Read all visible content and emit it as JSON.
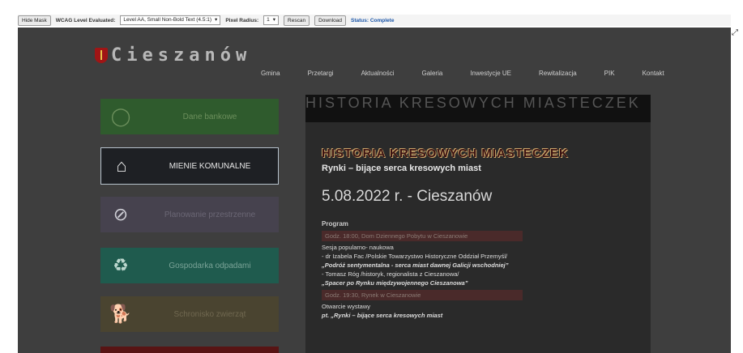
{
  "toolbar": {
    "hide_mask": "Hide Mask",
    "wcag_label": "WCAG Level Evaluated:",
    "wcag_value": "Level AA, Small Non-Bold Text (4.5:1)",
    "pixel_radius_label": "Pixel Radius:",
    "pixel_radius_value": "1",
    "rescan": "Rescan",
    "download": "Download",
    "status": "Status: Complete"
  },
  "site": {
    "logo_text": "Cieszanów",
    "nav": [
      "Gmina",
      "Przetargi",
      "Aktualności",
      "Galeria",
      "Inwestycje UE",
      "Rewitalizacja",
      "PIK",
      "Kontakt"
    ]
  },
  "tiles": [
    {
      "label": "Dane bankowe",
      "icon": "shield-outline-icon"
    },
    {
      "label": "MIENIE KOMUNALNE",
      "icon": "house-icon"
    },
    {
      "label": "Planowanie przestrzenne",
      "icon": "compass-icon"
    },
    {
      "label": "Gospodarka odpadami",
      "icon": "recycle-icon"
    },
    {
      "label": "Schronisko zwierząt",
      "icon": "dog-icon"
    }
  ],
  "article": {
    "banner": "HISTORIA KRESOWYCH MIASTECZEK",
    "title": "HISTORIA KRESOWYCH MIASTECZEK",
    "subtitle": "Rynki – bijące serca kresowych miast",
    "date": "5.08.2022 r. - Cieszanów",
    "program": "Program",
    "slot1": "Godz. 18:00, Dom Dziennego Pobytu w Cieszanowie",
    "line1": "Sesja popularno- naukowa",
    "line2": "- dr Izabela Fac /Polskie Towarzystwo Historyczne Oddział Przemyśl/",
    "line3": "„Podróż sentymentalna - serca miast dawnej Galicji wschodniej”",
    "line4": "- Tomasz Róg /historyk, regionalista z Cieszanowa/",
    "line5": "„Spacer po Rynku międzywojennego Cieszanowa”",
    "slot2": "Godz. 19:30, Rynek w Cieszanowie",
    "line6": "Otwarcie wystawy",
    "line7": "pt. „Rynki – bijące serca kresowych miast"
  }
}
